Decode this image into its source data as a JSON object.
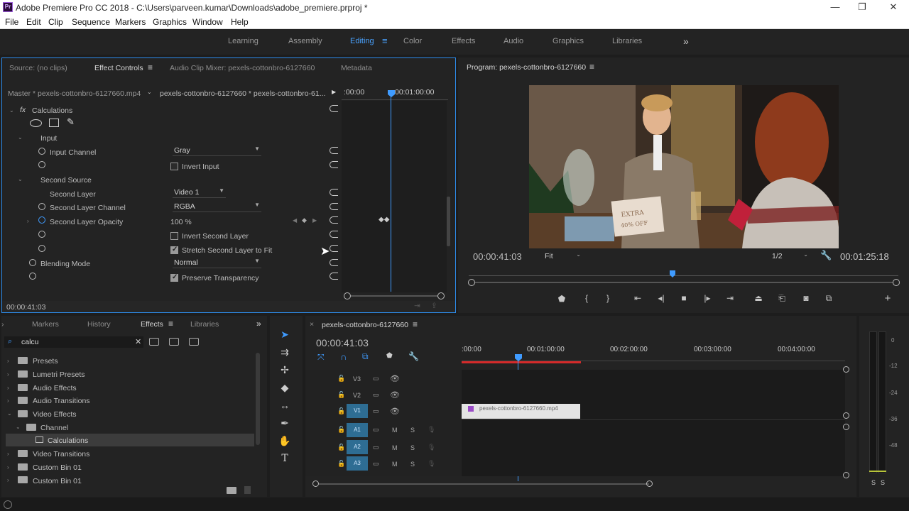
{
  "window": {
    "title": "Adobe Premiere Pro CC 2018 - C:\\Users\\parveen.kumar\\Downloads\\adobe_premiere.prproj *",
    "logo": "Pr",
    "min": "—",
    "max": "❐",
    "close": "✕"
  },
  "menu": [
    "File",
    "Edit",
    "Clip",
    "Sequence",
    "Markers",
    "Graphics",
    "Window",
    "Help"
  ],
  "workspaces": [
    "Learning",
    "Assembly",
    "Editing",
    "Color",
    "Effects",
    "Audio",
    "Graphics",
    "Libraries"
  ],
  "workspace_more": "»",
  "ec": {
    "tabs": [
      "Source: (no clips)",
      "Effect Controls",
      "Audio Clip Mixer: pexels-cottonbro-6127660",
      "Metadata"
    ],
    "master": "Master * pexels-cottonbro-6127660.mp4",
    "clip": "pexels-cottonbro-6127660 * pexels-cottonbro-61...",
    "t0": ":00:00",
    "t1": "00:01:00:00",
    "fx": "fx",
    "effect": "Calculations",
    "input": "Input",
    "input_channel": "Input Channel",
    "input_channel_val": "Gray",
    "invert_input": "Invert Input",
    "second_source": "Second Source",
    "second_layer": "Second Layer",
    "second_layer_val": "Video 1",
    "second_layer_channel": "Second Layer Channel",
    "second_layer_channel_val": "RGBA",
    "second_layer_opacity": "Second Layer Opacity",
    "opacity_val": "100 %",
    "invert_second": "Invert Second Layer",
    "stretch": "Stretch Second Layer to Fit",
    "blending": "Blending Mode",
    "blending_val": "Normal",
    "preserve": "Preserve Transparency",
    "timecode": "00:00:41:03"
  },
  "program": {
    "title": "Program: pexels-cottonbro-6127660",
    "timecode": "00:00:41:03",
    "fit": "Fit",
    "res": "1/2",
    "duration": "00:01:25:18",
    "sign_line1": "EXTRA",
    "sign_line2": "40% OFF"
  },
  "effects": {
    "tabs": [
      "Markers",
      "History",
      "Effects",
      "Libraries"
    ],
    "search": "calcu",
    "more": "»",
    "items": [
      "Presets",
      "Lumetri Presets",
      "Audio Effects",
      "Audio Transitions",
      "Video Effects",
      "Channel",
      "Calculations",
      "Video Transitions",
      "Custom Bin 01",
      "Custom Bin 01"
    ]
  },
  "timeline": {
    "tab": "pexels-cottonbro-6127660",
    "timecode": "00:00:41:03",
    "ruler": [
      ":00:00",
      "00:01:00:00",
      "00:02:00:00",
      "00:03:00:00",
      "00:04:00:00"
    ],
    "tracks": [
      "V3",
      "V2",
      "V1",
      "A1",
      "A2",
      "A3"
    ],
    "m": "M",
    "s": "S",
    "clip": "pexels-cottonbro-6127660.mp4"
  },
  "meter": {
    "labels": [
      "0",
      "-12",
      "-24",
      "-36",
      "-48"
    ],
    "ss": "S"
  }
}
